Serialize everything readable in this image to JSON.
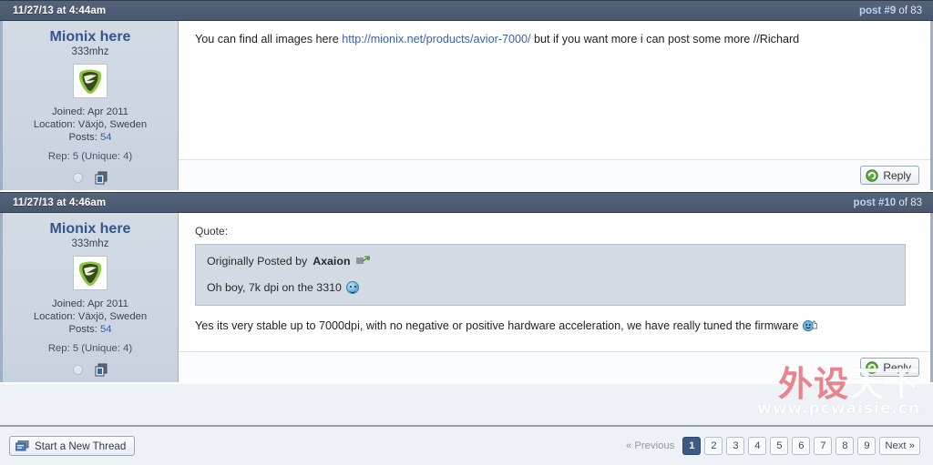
{
  "colors": {
    "header_bar": "#4d5c74",
    "user_panel": "#cfd7e2",
    "link": "#3a5fa8",
    "username": "#33558e",
    "active_page": "#3c5a86",
    "quote_bg": "#d4dae3",
    "watermark_red": "#e8737d"
  },
  "posts": [
    {
      "date": "11/27/13 at 4:44am",
      "post_number_label": "post #9",
      "post_total_label": "of 83",
      "user": {
        "name": "Mionix here",
        "title": "333mhz",
        "joined": "Joined: Apr 2011",
        "location": "Location: Växjö, Sweden",
        "posts_label": "Posts:",
        "posts_count": "54",
        "rep": "Rep: 5 (Unique: 4)",
        "avatar_alt": "mionix-logo-avatar",
        "status_icon": "offline-status-icon",
        "find_posts_icon": "find-posts-icon"
      },
      "message": {
        "before_link": "You can find all images here ",
        "link_text": "http://mionix.net/products/avior-7000/",
        "after_link": " but if you want more i can post some more //Richard"
      },
      "reply_label": "Reply",
      "reply_icon": "reply-arrow-icon"
    },
    {
      "date": "11/27/13 at 4:46am",
      "post_number_label": "post #10",
      "post_total_label": "of 83",
      "user": {
        "name": "Mionix here",
        "title": "333mhz",
        "joined": "Joined: Apr 2011",
        "location": "Location: Växjö, Sweden",
        "posts_label": "Posts:",
        "posts_count": "54",
        "rep": "Rep: 5 (Unique: 4)",
        "avatar_alt": "mionix-logo-avatar",
        "status_icon": "offline-status-icon",
        "find_posts_icon": "find-posts-icon"
      },
      "quote": {
        "label": "Quote:",
        "attribution_prefix": "Originally Posted by",
        "attribution_author": "Axaion",
        "view_post_icon": "view-post-arrow-icon",
        "text": "Oh boy, 7k dpi on the 3310",
        "emoticon": "blue-smiley-emoticon"
      },
      "message": {
        "text": "Yes its very stable up to 7000dpi, with no negative or positive hardware acceleration, we have really tuned the firmware",
        "emoticon": "thumbs-up-smiley-emoticon"
      },
      "reply_label": "Reply",
      "reply_icon": "reply-arrow-icon"
    }
  ],
  "bottom_bar": {
    "new_thread_label": "Start a New Thread",
    "new_thread_icon": "new-thread-icon",
    "pagination": {
      "previous_label": "« Previous",
      "next_label": "Next »",
      "pages": [
        "1",
        "2",
        "3",
        "4",
        "5",
        "6",
        "7",
        "8",
        "9"
      ],
      "active_page": "1"
    }
  },
  "watermark": {
    "chinese_red": "外设",
    "chinese_white": "天下",
    "url": "www.pcwaisie.cn"
  }
}
